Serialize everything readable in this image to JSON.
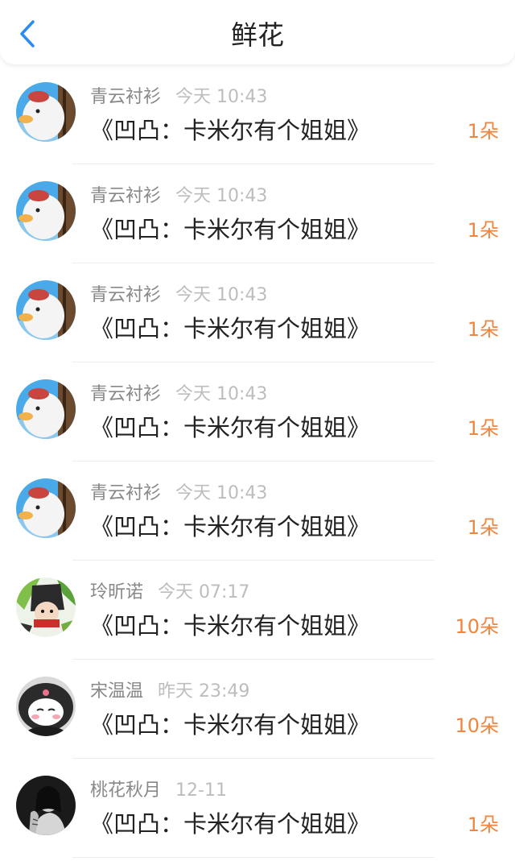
{
  "header": {
    "title": "鲜花",
    "back_icon": "chevron-left-icon",
    "accent_color": "#2b8bf2"
  },
  "count_color": "#f0853f",
  "items": [
    {
      "username": "青云衬衫",
      "time": "今天 10:43",
      "book": "《凹凸：卡米尔有个姐姐》",
      "count": "1朵",
      "avatar": "duck-avatar"
    },
    {
      "username": "青云衬衫",
      "time": "今天 10:43",
      "book": "《凹凸：卡米尔有个姐姐》",
      "count": "1朵",
      "avatar": "duck-avatar"
    },
    {
      "username": "青云衬衫",
      "time": "今天 10:43",
      "book": "《凹凸：卡米尔有个姐姐》",
      "count": "1朵",
      "avatar": "duck-avatar"
    },
    {
      "username": "青云衬衫",
      "time": "今天 10:43",
      "book": "《凹凸：卡米尔有个姐姐》",
      "count": "1朵",
      "avatar": "duck-avatar"
    },
    {
      "username": "青云衬衫",
      "time": "今天 10:43",
      "book": "《凹凸：卡米尔有个姐姐》",
      "count": "1朵",
      "avatar": "duck-avatar"
    },
    {
      "username": "玲昕诺",
      "time": "今天 07:17",
      "book": "《凹凸：卡米尔有个姐姐》",
      "count": "10朵",
      "avatar": "anime-character-avatar"
    },
    {
      "username": "宋温温",
      "time": "昨天 23:49",
      "book": "《凹凸：卡米尔有个姐姐》",
      "count": "10朵",
      "avatar": "kuromi-avatar"
    },
    {
      "username": "桃花秋月",
      "time": "12-11",
      "book": "《凹凸：卡米尔有个姐姐》",
      "count": "1朵",
      "avatar": "portrait-photo-avatar"
    }
  ]
}
